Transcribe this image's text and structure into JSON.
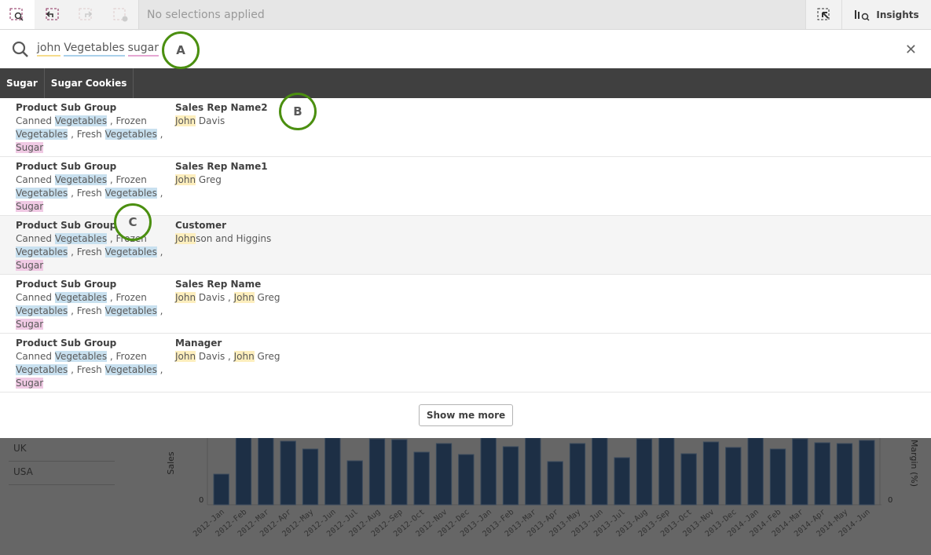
{
  "toolbar": {
    "selections_text": "No selections applied",
    "insights_label": "Insights",
    "icons": [
      "smart-search-icon",
      "step-back-icon",
      "step-forward-icon",
      "clear-selections-icon",
      "selection-tool-icon",
      "insights-icon"
    ]
  },
  "search": {
    "tokens": [
      {
        "text": "john",
        "color": "#f5dc8c"
      },
      {
        "text": "Vegetables",
        "color": "#a9d0ea"
      },
      {
        "text": "sugar",
        "color": "#e5a6d2"
      }
    ],
    "close_icon": "close-icon"
  },
  "chips": [
    "Sugar",
    "Sugar Cookies"
  ],
  "results": [
    {
      "left_header": "Product Sub Group",
      "right_header": "Sales Rep Name2",
      "right_parts": [
        [
          "John",
          "y"
        ],
        [
          " Davis",
          ""
        ]
      ]
    },
    {
      "left_header": "Product Sub Group",
      "right_header": "Sales Rep Name1",
      "right_parts": [
        [
          "John",
          "y"
        ],
        [
          " Greg",
          ""
        ]
      ]
    },
    {
      "left_header": "Product Sub Group",
      "right_header": "Customer",
      "right_parts": [
        [
          "John",
          "y"
        ],
        [
          "son and Higgins",
          ""
        ]
      ]
    },
    {
      "left_header": "Product Sub Group",
      "right_header": "Sales Rep Name",
      "right_parts": [
        [
          "John",
          "y"
        ],
        [
          " Davis , ",
          ""
        ],
        [
          "John",
          "y"
        ],
        [
          " Greg",
          ""
        ]
      ]
    },
    {
      "left_header": "Product Sub Group",
      "right_header": "Manager",
      "right_parts": [
        [
          "John",
          "y"
        ],
        [
          " Davis , ",
          ""
        ],
        [
          "John",
          "y"
        ],
        [
          " Greg",
          ""
        ]
      ]
    }
  ],
  "left_parts": [
    [
      "Canned ",
      ""
    ],
    [
      "Vegetables",
      "b"
    ],
    [
      " , Frozen ",
      ""
    ],
    [
      "Vegetables",
      "b"
    ],
    [
      " , Fresh ",
      ""
    ],
    [
      "Vegetables",
      "b"
    ],
    [
      " , ",
      ""
    ],
    [
      "Sugar",
      "p"
    ]
  ],
  "show_more_label": "Show me more",
  "callouts": [
    "A",
    "B",
    "C"
  ],
  "listbox": [
    "UK",
    "USA"
  ],
  "chart_data": {
    "type": "bar",
    "ylabel": "Sales",
    "y2label": "Margin (%)",
    "y_tick": "0",
    "y2_tick": "0",
    "categories": [
      "2012-Jan",
      "2012-Feb",
      "2012-Mar",
      "2012-Apr",
      "2012-May",
      "2012-Jun",
      "2012-Jul",
      "2012-Aug",
      "2012-Sep",
      "2012-Oct",
      "2012-Nov",
      "2012-Dec",
      "2013-Jan",
      "2013-Feb",
      "2013-Mar",
      "2013-Apr",
      "2013-May",
      "2013-Jun",
      "2013-Jul",
      "2013-Aug",
      "2013-Sep",
      "2013-Oct",
      "2013-Nov",
      "2013-Dec",
      "2014-Jan",
      "2014-Feb",
      "2014-Mar",
      "2014-Apr",
      "2014-May",
      "2014-Jun"
    ],
    "values": [
      39,
      95,
      95,
      81,
      71,
      95,
      56,
      84,
      83,
      67,
      78,
      64,
      95,
      74,
      95,
      55,
      78,
      95,
      60,
      84,
      95,
      65,
      80,
      73,
      95,
      71,
      84,
      79,
      78,
      82
    ],
    "bar_color": "#1d2f45"
  }
}
